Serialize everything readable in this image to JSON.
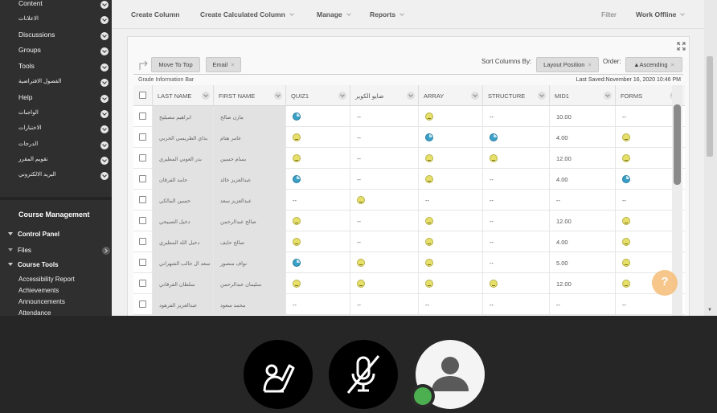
{
  "sidebar": {
    "items": [
      {
        "label": "Content",
        "icon": "chevron-down-icon"
      },
      {
        "label": "الاعلانات",
        "icon": "chevron-down-icon"
      },
      {
        "label": "Discussions",
        "icon": "chevron-down-icon"
      },
      {
        "label": "Groups",
        "icon": "chevron-down-icon"
      },
      {
        "label": "Tools",
        "icon": "chevron-down-icon"
      },
      {
        "label": "الفصول الافتراضية",
        "icon": "chevron-down-icon"
      },
      {
        "label": "Help",
        "icon": "chevron-down-icon"
      },
      {
        "label": "الواجبات",
        "icon": "chevron-down-icon"
      },
      {
        "label": "الاختبارات",
        "icon": "chevron-down-icon"
      },
      {
        "label": "الدرجات",
        "icon": "chevron-down-icon"
      },
      {
        "label": "تقويم المقرر",
        "icon": "chevron-down-icon"
      },
      {
        "label": "البريد الالكتروني",
        "icon": "chevron-down-icon"
      }
    ],
    "course_management": {
      "title": "Course Management",
      "control_panel": "Control Panel",
      "files": "Files",
      "course_tools": "Course Tools",
      "tools": [
        "Accessibility Report",
        "Achievements",
        "Announcements",
        "Attendance"
      ]
    }
  },
  "toolbar": {
    "create_column": "Create Column",
    "create_calculated_column": "Create Calculated Column",
    "manage": "Manage",
    "reports": "Reports",
    "filter": "Filter",
    "work_offline": "Work Offline"
  },
  "actions": {
    "move_to_top": "Move To Top",
    "email": "Email",
    "sort_columns_by": "Sort Columns By:",
    "layout_position": "Layout Position",
    "order": "Order:",
    "ascending": "▲Ascending",
    "grade_information_bar": "Grade Information Bar",
    "last_saved": "Last Saved:November 16, 2020 10:46 PM"
  },
  "grid": {
    "columns": [
      "LAST NAME",
      "FIRST NAME",
      "QUIZ1",
      "ضايو الكوير",
      "ARRAY",
      "STRUCTURE",
      "MID1",
      "FORMS"
    ],
    "rows": [
      {
        "last": "ابراهيم مصيليخ",
        "first": "مازن صالح",
        "quiz1": "progress",
        "q2": "--",
        "array": "needs",
        "structure": "--",
        "mid1": "10.00",
        "forms": "--"
      },
      {
        "last": "بداي الطريسي الحربي",
        "first": "عامر هتام",
        "quiz1": "needs",
        "q2": "--",
        "array": "progress",
        "structure": "progress",
        "mid1": "4.00",
        "forms": "needs"
      },
      {
        "last": "بدر العوني المطيري",
        "first": "بسام حسين",
        "quiz1": "needs",
        "q2": "--",
        "array": "needs",
        "structure": "needs",
        "mid1": "12.00",
        "forms": "needs"
      },
      {
        "last": "حامد القرقان",
        "first": "عبدالعزيز خالد",
        "quiz1": "progress",
        "q2": "--",
        "array": "needs",
        "structure": "--",
        "mid1": "4.00",
        "forms": "progress"
      },
      {
        "last": "حسين المالكي",
        "first": "عبدالعزيز سعد",
        "quiz1": "--",
        "q2": "needs",
        "array": "--",
        "structure": "--",
        "mid1": "--",
        "forms": "--"
      },
      {
        "last": "دخيل الصبيحي",
        "first": "صالح عبدالرحمن",
        "quiz1": "needs",
        "q2": "--",
        "array": "needs",
        "structure": "--",
        "mid1": "12.00",
        "forms": "needs"
      },
      {
        "last": "دخيل الله المطيري",
        "first": "صالح حايف",
        "quiz1": "needs",
        "q2": "--",
        "array": "needs",
        "structure": "--",
        "mid1": "4.00",
        "forms": "needs"
      },
      {
        "last": "سعد ال جالب الشهراني",
        "first": "نواف منصور",
        "quiz1": "progress",
        "q2": "needs",
        "array": "needs",
        "structure": "--",
        "mid1": "5.00",
        "forms": "needs"
      },
      {
        "last": "سلطان الفرقاني",
        "first": "سليمان عبدالرحمن",
        "quiz1": "needs",
        "q2": "needs",
        "array": "needs",
        "structure": "needs",
        "mid1": "12.00",
        "forms": "needs"
      },
      {
        "last": "عبدالعزيز الفرهود",
        "first": "محمد سعود",
        "quiz1": "--",
        "q2": "--",
        "array": "--",
        "structure": "--",
        "mid1": "--",
        "forms": "--"
      }
    ]
  },
  "help": {
    "label": "?"
  },
  "colors": {
    "accent_help": "#f6c07e",
    "status_online": "#4caf50",
    "sidebar_bg": "#2f2f2f"
  }
}
